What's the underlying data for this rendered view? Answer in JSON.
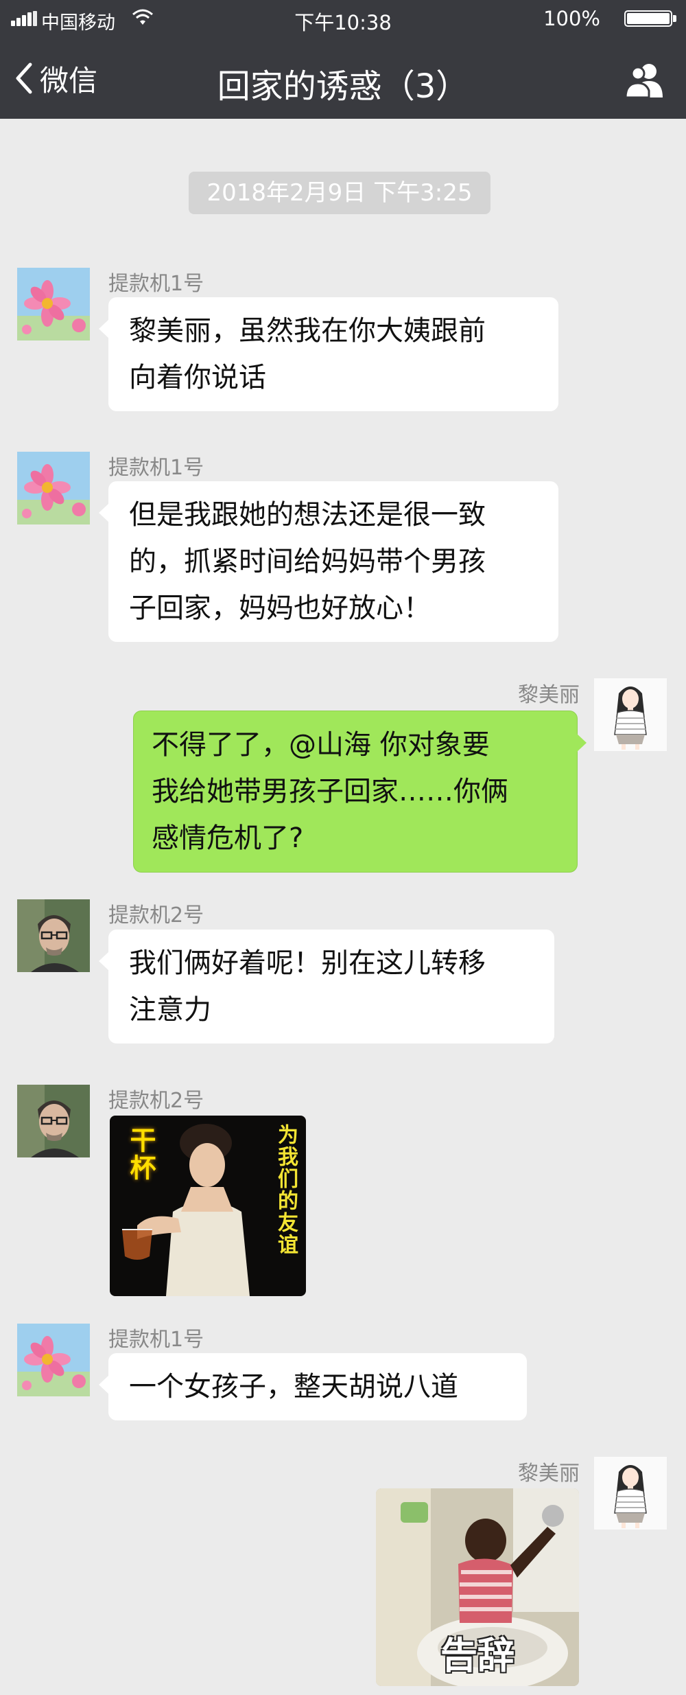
{
  "status_bar": {
    "carrier": "中国移动",
    "time": "下午10:38",
    "battery": "100%",
    "battery_level": 1.0
  },
  "nav": {
    "back_label": "微信",
    "title": "回家的诱惑（3）",
    "group_icon": "group-members-icon"
  },
  "timestamp": "2018年2月9日 下午3:25",
  "messages": [
    {
      "sender": "提款机1号",
      "avatar": "pink-cosmos-flower-avatar",
      "lines": [
        "黎美丽，虽然我在你大姨跟前",
        "向着你说话"
      ]
    },
    {
      "sender": "提款机1号",
      "avatar": "pink-cosmos-flower-avatar",
      "lines": [
        "但是我跟她的想法还是很一致",
        "的，抓紧时间给妈妈带个男孩",
        "子回家，妈妈也好放心！"
      ]
    },
    {
      "sender": "黎美丽",
      "avatar": "drawn-girl-avatar",
      "lines": [
        "不得了了，@山海 你对象要",
        "我给她带男孩子回家……你俩",
        "感情危机了?"
      ]
    },
    {
      "sender": "提款机2号",
      "avatar": "man-with-glasses-avatar",
      "lines": [
        "我们俩好着呢！别在这儿转移",
        "注意力"
      ]
    },
    {
      "sender": "提款机2号",
      "avatar": "man-with-glasses-avatar",
      "sticker": {
        "left_caption": "干杯",
        "right_caption": "为我们的友谊"
      }
    },
    {
      "sender": "提款机1号",
      "avatar": "pink-cosmos-flower-avatar",
      "lines": [
        "一个女孩子，整天胡说八道"
      ]
    },
    {
      "sender": "黎美丽",
      "avatar": "drawn-girl-avatar",
      "sticker": {
        "caption": "告辞"
      }
    }
  ],
  "colors": {
    "nav_bg": "#393a3f",
    "chat_bg": "#ebebeb",
    "outgoing_bubble": "#a0e75a",
    "incoming_bubble": "#ffffff"
  }
}
